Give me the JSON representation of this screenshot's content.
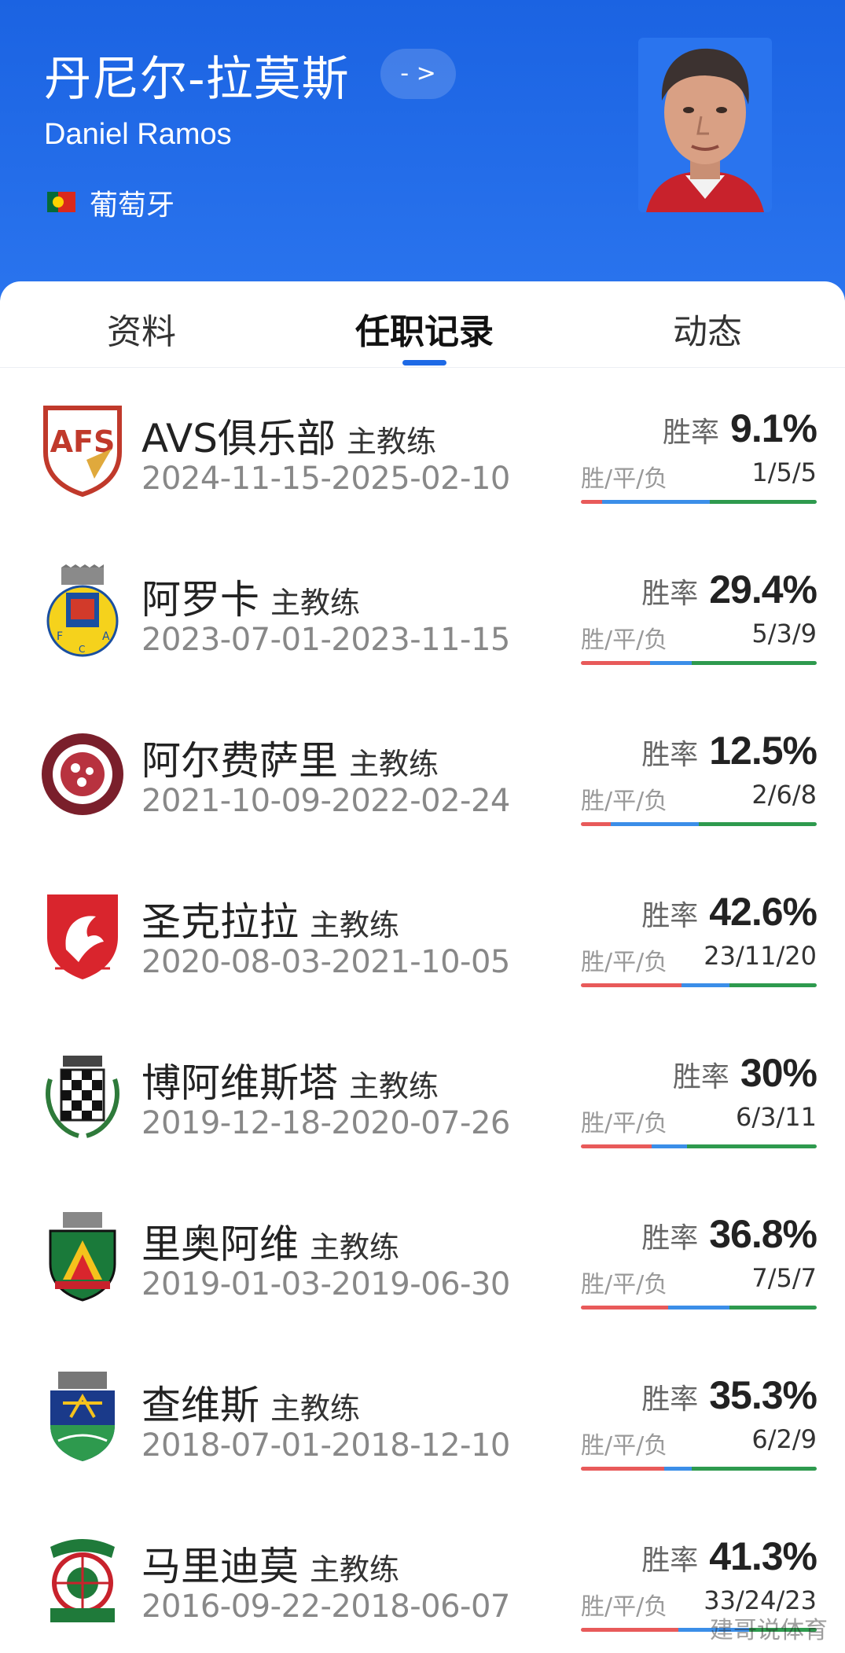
{
  "header": {
    "name_cn": "丹尼尔-拉莫斯",
    "arrow_label": "- >",
    "name_en": "Daniel Ramos",
    "nationality": "葡萄牙",
    "flag_icon": "portugal-flag-icon"
  },
  "tabs": [
    {
      "label": "资料"
    },
    {
      "label": "任职记录",
      "active": true
    },
    {
      "label": "动态"
    }
  ],
  "labels": {
    "rate": "胜率",
    "wdl": "胜/平/负"
  },
  "colors": {
    "win": "#e85a5a",
    "draw": "#3b8ee8",
    "loss": "#2e9a4e",
    "accent": "#1e6ae6"
  },
  "records": [
    {
      "team": "AVS俱乐部",
      "role": "主教练",
      "dates": "2024-11-15-2025-02-10",
      "rate": "9.1%",
      "wdl": "1/5/5",
      "w": 1,
      "d": 5,
      "l": 5,
      "logo": "avs-logo-icon"
    },
    {
      "team": "阿罗卡",
      "role": "主教练",
      "dates": "2023-07-01-2023-11-15",
      "rate": "29.4%",
      "wdl": "5/3/9",
      "w": 5,
      "d": 3,
      "l": 9,
      "logo": "arouca-logo-icon"
    },
    {
      "team": "阿尔费萨里",
      "role": "主教练",
      "dates": "2021-10-09-2022-02-24",
      "rate": "12.5%",
      "wdl": "2/6/8",
      "w": 2,
      "d": 6,
      "l": 8,
      "logo": "alfaisaly-logo-icon"
    },
    {
      "team": "圣克拉拉",
      "role": "主教练",
      "dates": "2020-08-03-2021-10-05",
      "rate": "42.6%",
      "wdl": "23/11/20",
      "w": 23,
      "d": 11,
      "l": 20,
      "logo": "santa-clara-logo-icon"
    },
    {
      "team": "博阿维斯塔",
      "role": "主教练",
      "dates": "2019-12-18-2020-07-26",
      "rate": "30%",
      "wdl": "6/3/11",
      "w": 6,
      "d": 3,
      "l": 11,
      "logo": "boavista-logo-icon"
    },
    {
      "team": "里奥阿维",
      "role": "主教练",
      "dates": "2019-01-03-2019-06-30",
      "rate": "36.8%",
      "wdl": "7/5/7",
      "w": 7,
      "d": 5,
      "l": 7,
      "logo": "rio-ave-logo-icon"
    },
    {
      "team": "查维斯",
      "role": "主教练",
      "dates": "2018-07-01-2018-12-10",
      "rate": "35.3%",
      "wdl": "6/2/9",
      "w": 6,
      "d": 2,
      "l": 9,
      "logo": "chaves-logo-icon"
    },
    {
      "team": "马里迪莫",
      "role": "主教练",
      "dates": "2016-09-22-2018-06-07",
      "rate": "41.3%",
      "wdl": "33/24/23",
      "w": 33,
      "d": 24,
      "l": 23,
      "logo": "maritimo-logo-icon"
    }
  ],
  "watermark": "建哥说体育"
}
